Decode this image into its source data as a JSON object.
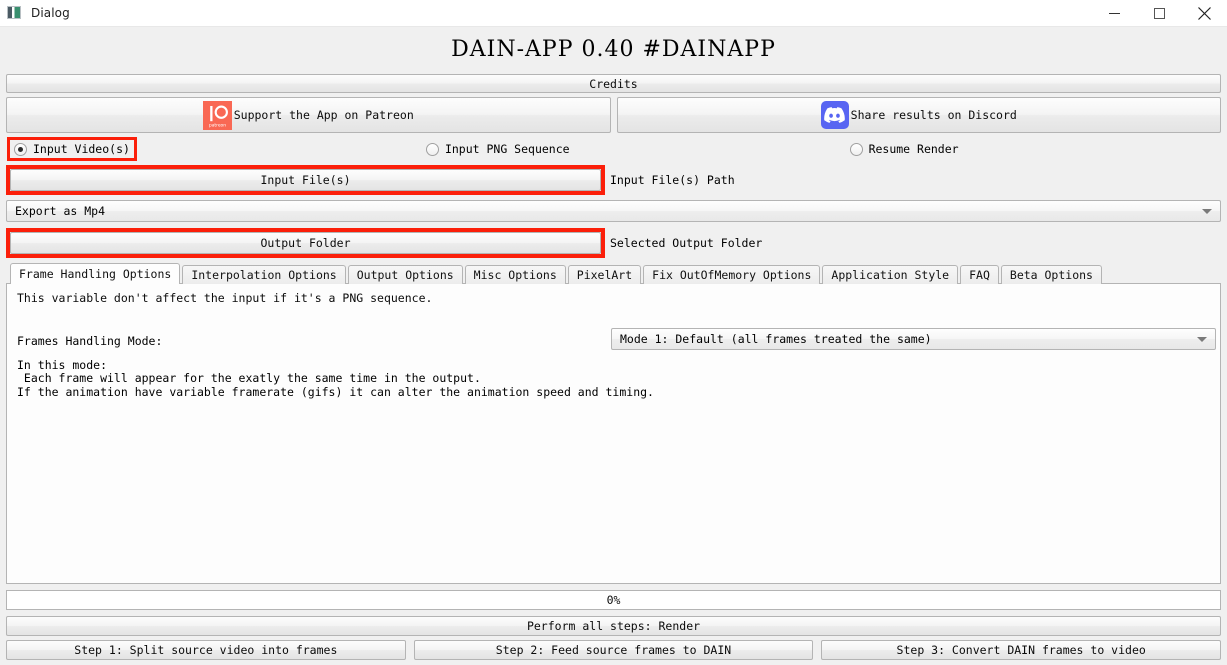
{
  "window": {
    "title": "Dialog",
    "icon": "app-icon",
    "controls": {
      "minimize": "minimize-icon",
      "maximize": "maximize-icon",
      "close": "close-icon"
    }
  },
  "app": {
    "title": "DAIN-APP 0.40 #DAINAPP",
    "credits_label": "Credits"
  },
  "social": {
    "patreon": {
      "label": "Support the App on Patreon",
      "icon": "patreon-icon",
      "color": "#f96854"
    },
    "discord": {
      "label": "Share results on Discord",
      "icon": "discord-icon",
      "color": "#5865f2"
    }
  },
  "input_mode": {
    "options": [
      {
        "label": "Input Video(s)",
        "checked": true,
        "highlighted": true
      },
      {
        "label": "Input PNG Sequence",
        "checked": false,
        "highlighted": false
      },
      {
        "label": "Resume Render",
        "checked": false,
        "highlighted": false
      }
    ]
  },
  "input_file": {
    "button_label": "Input File(s)",
    "path_label": "Input File(s) Path",
    "highlighted": true
  },
  "export": {
    "selected": "Export as Mp4"
  },
  "output_folder": {
    "button_label": "Output Folder",
    "path_label": "Selected Output Folder",
    "highlighted": true
  },
  "tabs": [
    {
      "label": "Frame Handling Options",
      "active": true
    },
    {
      "label": "Interpolation Options",
      "active": false
    },
    {
      "label": "Output Options",
      "active": false
    },
    {
      "label": "Misc Options",
      "active": false
    },
    {
      "label": "PixelArt",
      "active": false
    },
    {
      "label": "Fix OutOfMemory Options",
      "active": false
    },
    {
      "label": "Application Style",
      "active": false
    },
    {
      "label": "FAQ",
      "active": false
    },
    {
      "label": "Beta Options",
      "active": false
    }
  ],
  "frame_handling_panel": {
    "note": "This variable don't affect the input if it's a PNG sequence.",
    "mode_label": "Frames Handling Mode:",
    "mode_selected": "Mode 1: Default (all frames treated the same)",
    "description": "In this mode:\n Each frame will appear for the exatly the same time in the output.\nIf the animation have variable framerate (gifs) it can alter the animation speed and timing."
  },
  "progress": {
    "percent_label": "0%",
    "value": 0
  },
  "actions": {
    "render_all": "Perform all steps: Render",
    "steps": [
      "Step 1: Split source video into frames",
      "Step 2: Feed source frames to DAIN",
      "Step 3: Convert DAIN frames to video"
    ]
  },
  "colors": {
    "highlight": "#fb1f0a",
    "background": "#f0f0f0",
    "panel": "#fdfdfd"
  }
}
